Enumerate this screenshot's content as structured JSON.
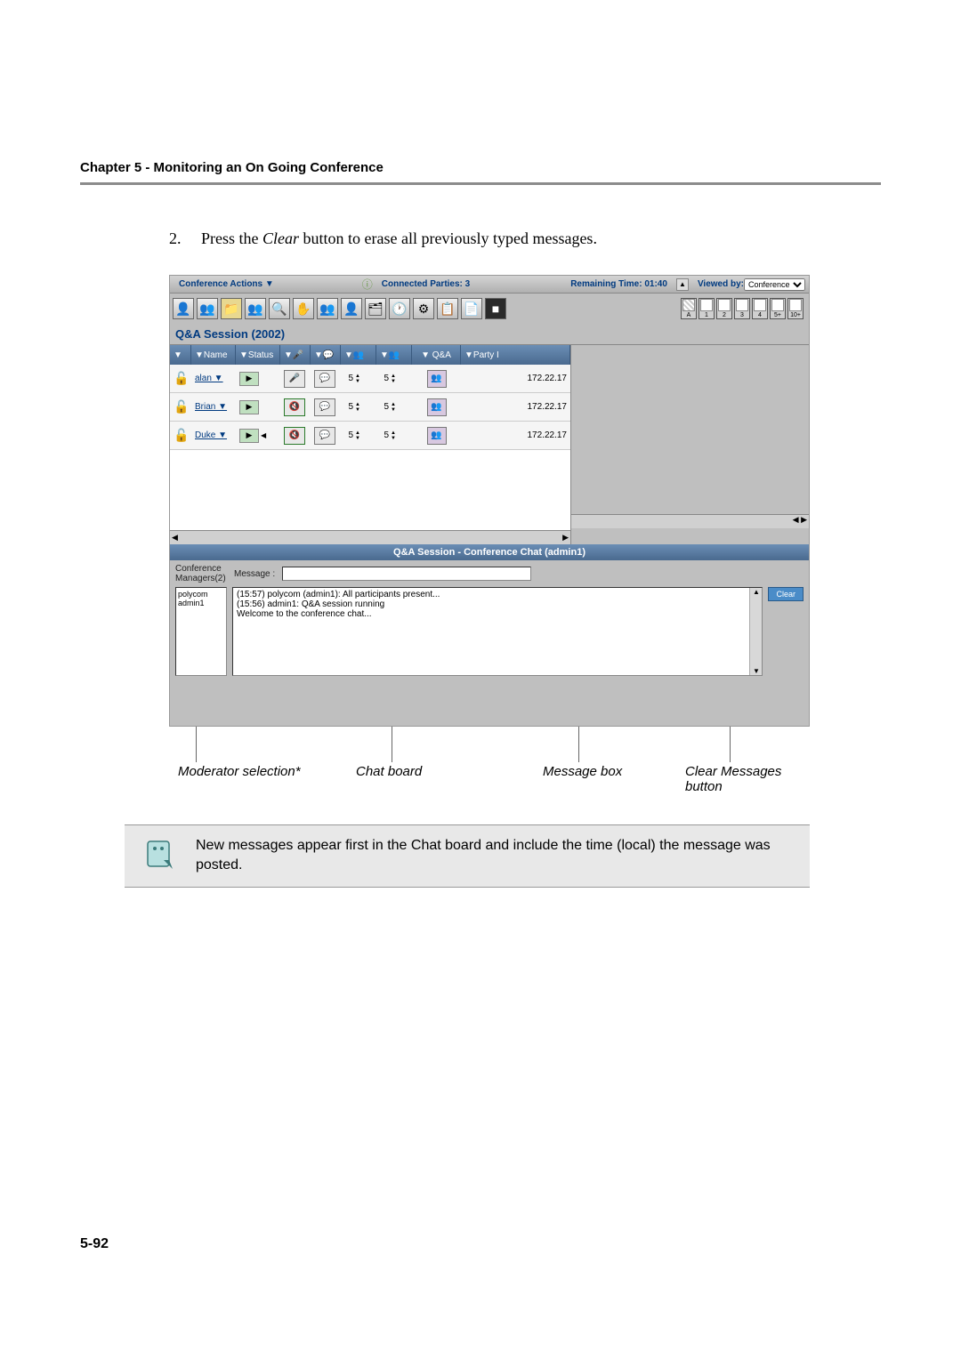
{
  "chapterHeader": "Chapter 5 - Monitoring an On Going Conference",
  "stepNumber": "2.",
  "stepTextPre": "Press the ",
  "stepTextItalic": "Clear",
  "stepTextPost": " button to erase all previously typed messages.",
  "confBar": {
    "actions": "Conference Actions ▼",
    "connectedParties": "Connected Parties: 3",
    "remainingTime": "Remaining Time: 01:40",
    "viewedBy": "Viewed by:",
    "viewedOption": "Conference"
  },
  "layoutLabels": [
    "A",
    "1",
    "2",
    "3",
    "4",
    "5+",
    "10+"
  ],
  "sessionTitle": "Q&A Session (2002)",
  "columns": {
    "c1": "▼",
    "name": "▼Name",
    "status": "▼Status",
    "mic": "▼🎤",
    "chat": "▼💬",
    "sp1": "▼👥",
    "sp2": "▼👥",
    "qa": "▼ Q&A",
    "party": "▼Party I"
  },
  "rows": [
    {
      "name": "alan ▼",
      "s1": "5",
      "s2": "5",
      "ip": "172.22.17"
    },
    {
      "name": "Brian ▼",
      "s1": "5",
      "s2": "5",
      "ip": "172.22.17"
    },
    {
      "name": "Duke ▼",
      "s1": "5",
      "s2": "5",
      "ip": "172.22.17"
    }
  ],
  "chatHeader": "Q&A Session - Conference Chat (admin1)",
  "managersLabel": "Conference Managers(2)",
  "messageLabel": "Message :",
  "managers": [
    "polycom",
    "admin1"
  ],
  "chatLines": [
    "(15:57) polycom (admin1): All participants present...",
    "(15:56) admin1: Q&A session running",
    "Welcome to the conference chat..."
  ],
  "clearLabel": "Clear",
  "annotations": {
    "moderator": "Moderator selection*",
    "chatboard": "Chat board",
    "msgbox": "Message box",
    "clearbtn": "Clear Messages button"
  },
  "noteText": "New messages appear first in the Chat board and include the time (local) the message was posted.",
  "pageNumber": "5-92"
}
